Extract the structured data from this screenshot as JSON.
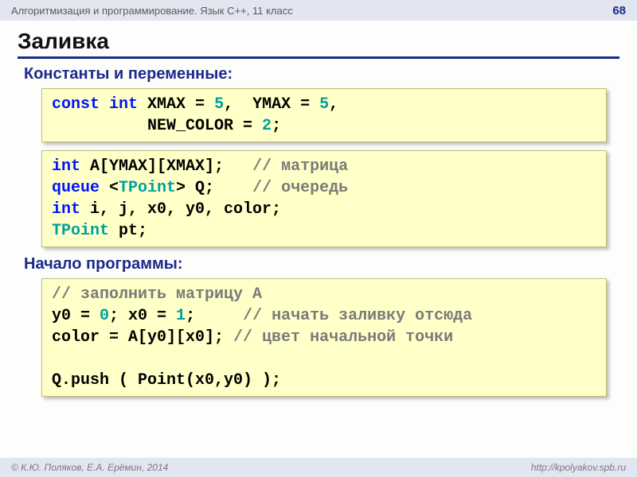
{
  "header": {
    "course": "Алгоритмизация и программирование. Язык C++, 11 класс",
    "page": "68"
  },
  "title": "Заливка",
  "section1": "Константы и переменные:",
  "code1": {
    "l1_kw1": "const",
    "l1_kw2": "int",
    "l1_rest": " XMAX = ",
    "l1_n1": "5",
    "l1_c1": ",  YMAX = ",
    "l1_n2": "5",
    "l1_c2": ",",
    "l2_pad": "          NEW_COLOR = ",
    "l2_n": "2",
    "l2_end": ";"
  },
  "code2": {
    "l1_kw": "int",
    "l1_rest": " A[YMAX][XMAX];   ",
    "l1_cmt": "// матрица",
    "l2_kw": "queue",
    "l2_lt": " <",
    "l2_typ": "TPoint",
    "l2_gt": "> Q;    ",
    "l2_cmt": "// очередь",
    "l3_kw": "int",
    "l3_rest": " i, j, x0, y0, color;",
    "l4_typ": "TPoint",
    "l4_rest": " pt;"
  },
  "section2": "Начало программы:",
  "code3": {
    "l1_cmt": "// заполнить матрицу A",
    "l2_a": "y0 = ",
    "l2_n1": "0",
    "l2_b": "; x0 = ",
    "l2_n2": "1",
    "l2_c": ";     ",
    "l2_cmt": "// начать заливку отсюда",
    "l3_a": "color = A[y0][x0]; ",
    "l3_cmt": "// цвет начальной точки",
    "l4": " ",
    "l5": "Q.push ( Point(x0,y0) );"
  },
  "footer": {
    "left": "© К.Ю. Поляков, Е.А. Ерёмин, 2014",
    "right": "http://kpolyakov.spb.ru"
  }
}
